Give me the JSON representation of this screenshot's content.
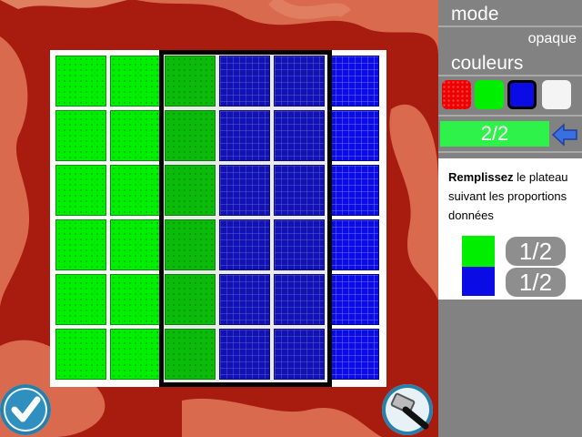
{
  "panel": {
    "mode_label": "mode",
    "mode_value": "opaque",
    "colors_label": "couleurs",
    "swatches": [
      {
        "name": "red",
        "color": "#ee0000"
      },
      {
        "name": "green",
        "color": "#00ee00"
      },
      {
        "name": "blue",
        "color": "#0b0be6",
        "selected": true
      },
      {
        "name": "white",
        "color": "#f4f4f4"
      }
    ],
    "progress_text": "2/2",
    "progress_color": "#2ef24a",
    "instruction_bold": "Remplissez",
    "instruction_rest": " le plateau suivant les proportions données",
    "legend": [
      {
        "color": "#00ee00",
        "fraction": "1/2"
      },
      {
        "color": "#0b0be6",
        "fraction": "1/2"
      }
    ]
  },
  "board": {
    "columns": [
      "green",
      "green",
      "green",
      "blue",
      "blue",
      "blue"
    ],
    "rows": 6,
    "selected_columns": [
      2,
      3,
      4
    ]
  },
  "buttons": {
    "validate_icon": "checkmark-icon",
    "tool_icon": "hammer-icon",
    "back_icon": "back-arrow-icon"
  }
}
